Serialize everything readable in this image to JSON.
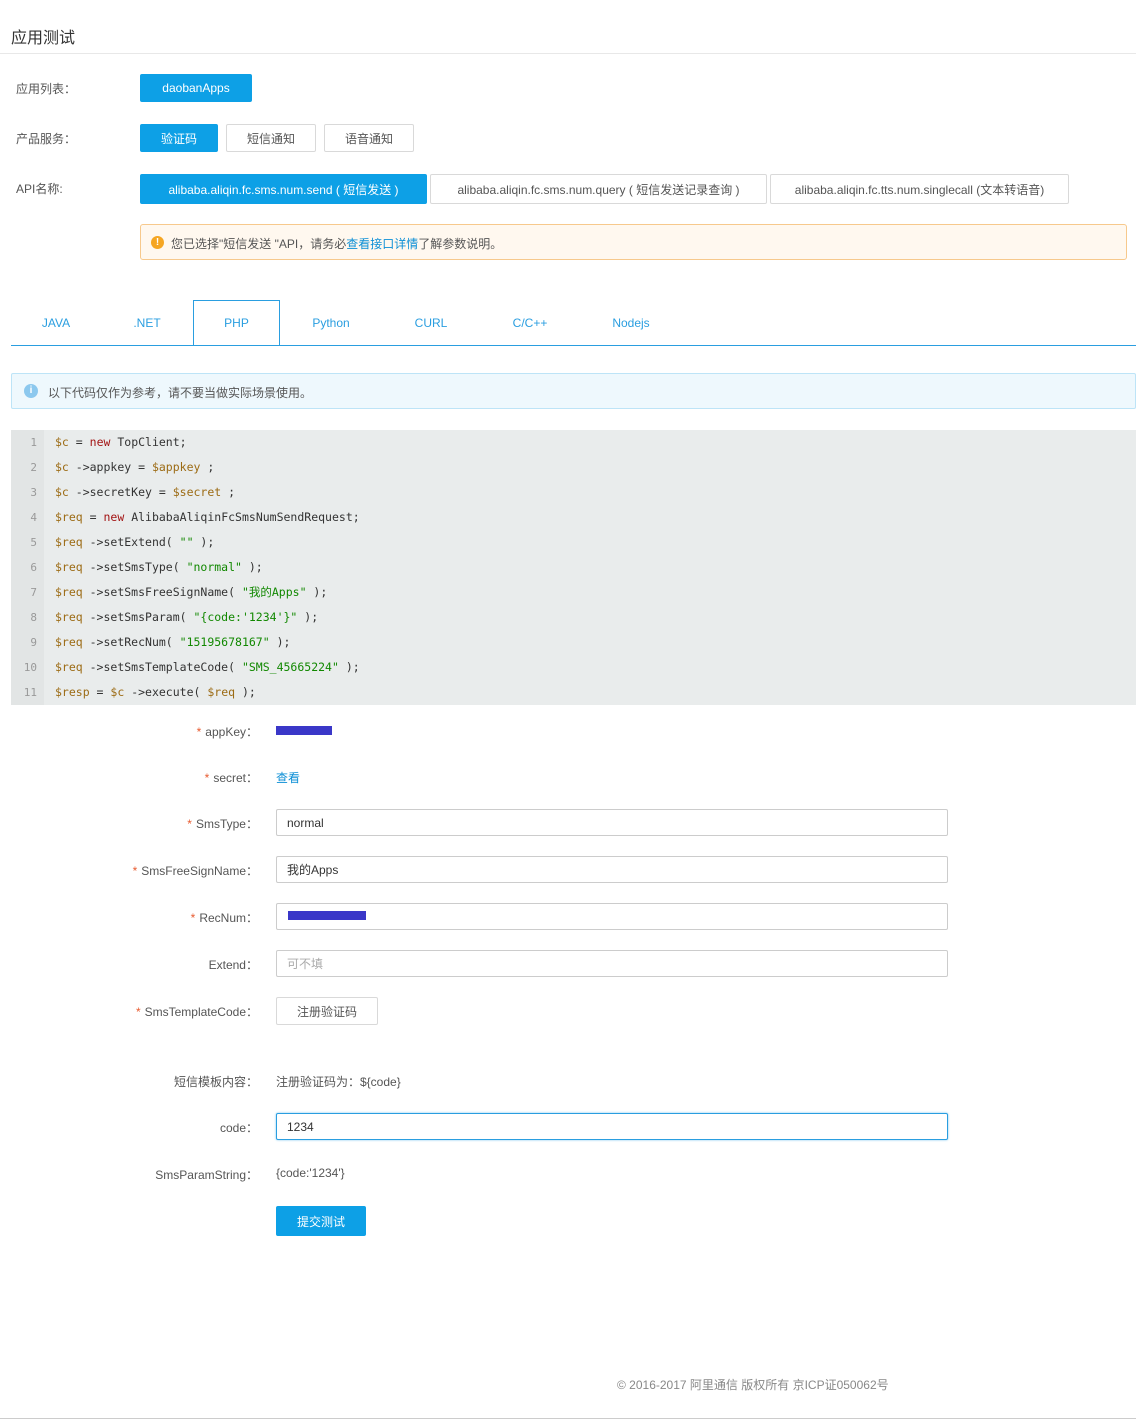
{
  "page": {
    "title": "应用测试"
  },
  "app_list": {
    "label": "应用列表：",
    "app": "daobanApps"
  },
  "product": {
    "label": "产品服务：",
    "options": [
      "验证码",
      "短信通知",
      "语音通知"
    ]
  },
  "api": {
    "label": "API名称:",
    "options": [
      "alibaba.aliqin.fc.sms.num.send ( 短信发送 )",
      "alibaba.aliqin.fc.sms.num.query ( 短信发送记录查询 )",
      "alibaba.aliqin.fc.tts.num.singlecall (文本转语音)"
    ]
  },
  "notice": {
    "prefix": "您已选择\"短信发送 \"API，请务必",
    "link": "查看接口详情",
    "suffix": "了解参数说明。"
  },
  "tabs": [
    "JAVA",
    ".NET",
    "PHP",
    "Python",
    "CURL",
    "C/C++",
    "Nodejs"
  ],
  "info": "以下代码仅作为参考，请不要当做实际场景使用。",
  "code": [
    "$c = new TopClient;",
    "$c ->appkey = $appkey ;",
    "$c ->secretKey = $secret ;",
    "$req = new AlibabaAliqinFcSmsNumSendRequest;",
    "$req ->setExtend( \"\" );",
    "$req ->setSmsType( \"normal\" );",
    "$req ->setSmsFreeSignName( \"我的Apps\" );",
    "$req ->setSmsParam( \"{code:'1234'}\" );",
    "$req ->setRecNum( \"15195678167\" );",
    "$req ->setSmsTemplateCode( \"SMS_45665224\" );",
    "$resp = $c ->execute( $req );"
  ],
  "form": {
    "appkey_label": "appKey：",
    "secret_label": "secret：",
    "secret_link": "查看",
    "smstype_label": "SmsType：",
    "smstype_value": "normal",
    "sign_label": "SmsFreeSignName：",
    "sign_value": "我的Apps",
    "recnum_label": "RecNum：",
    "extend_label": "Extend：",
    "extend_placeholder": "可不填",
    "template_label": "SmsTemplateCode：",
    "template_button": "注册验证码",
    "template_content_label": "短信模板内容：",
    "template_content": "注册验证码为：${code}",
    "code_label": "code：",
    "code_value": "1234",
    "param_label": "SmsParamString：",
    "param_value": "{code:'1234'}",
    "submit": "提交测试"
  },
  "footer": "© 2016-2017 阿里通信 版权所有 京ICP证050062号",
  "colors": {
    "primary": "#0da0e6",
    "link": "#0d8fd6",
    "required": "#e85b30"
  }
}
